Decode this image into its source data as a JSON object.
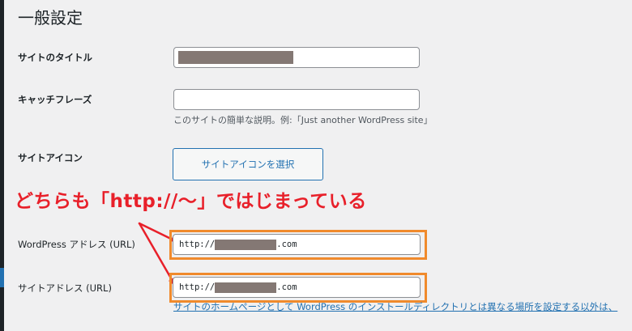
{
  "page": {
    "title": "一般設定"
  },
  "fields": {
    "site_title": {
      "label": "サイトのタイトル",
      "value_redacted": true
    },
    "tagline": {
      "label": "キャッチフレーズ",
      "value": "",
      "description": "このサイトの簡単な説明。例:「Just another WordPress site」"
    },
    "site_icon": {
      "label": "サイトアイコン",
      "button_label": "サイトアイコンを選択"
    },
    "wordpress_address": {
      "label": "WordPress アドレス (URL)",
      "value_prefix": "http://",
      "value_suffix": ".com",
      "middle_redacted": true
    },
    "site_address": {
      "label": "サイトアドレス (URL)",
      "value_prefix": "http://",
      "value_suffix": ".com",
      "middle_redacted": true,
      "help_link": "サイトのホームページとして WordPress のインストールディレクトリとは異なる場所を設定する以外は、"
    }
  },
  "annotation": {
    "text": "どちらも「http://〜」ではじまっている",
    "color": "#e8202a",
    "highlight_color": "#f08a2c"
  },
  "colors": {
    "background": "#f0f0f1",
    "link": "#2271b1",
    "redaction": "#847874"
  }
}
